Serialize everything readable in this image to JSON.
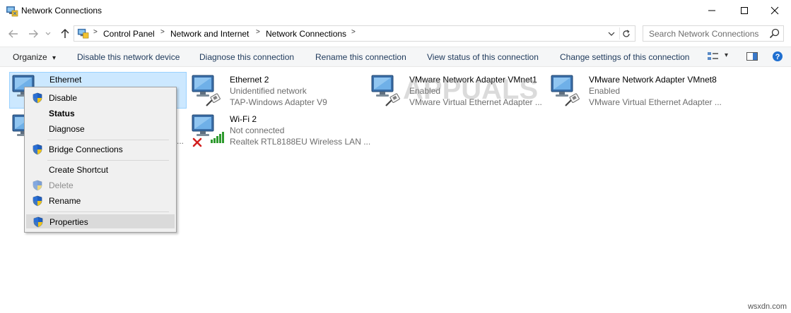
{
  "window": {
    "title": "Network Connections",
    "icon": "network-connections-icon",
    "controls": [
      "minimize-icon",
      "maximize-icon",
      "close-icon"
    ]
  },
  "address": {
    "crumbs": [
      "Control Panel",
      "Network and Internet",
      "Network Connections"
    ],
    "separator": ">",
    "search_placeholder": "Search Network Connections"
  },
  "toolbar": {
    "organize": "Organize",
    "organize_arrow": "▾",
    "commands": [
      "Disable this network device",
      "Diagnose this connection",
      "Rename this connection",
      "View status of this connection",
      "Change settings of this connection"
    ],
    "view_arrow": "▾"
  },
  "connections": [
    {
      "name": "Ethernet",
      "status": "",
      "adapter": "",
      "selected": true
    },
    {
      "name": "Ethernet 2",
      "status": "Unidentified network",
      "adapter": "TAP-Windows Adapter V9"
    },
    {
      "name": "VMware Network Adapter VMnet1",
      "status": "Enabled",
      "adapter": "VMware Virtual Ethernet Adapter ..."
    },
    {
      "name": "VMware Network Adapter VMnet8",
      "status": "Enabled",
      "adapter": "VMware Virtual Ethernet Adapter ..."
    },
    {
      "name": "Wi-Fi 2",
      "status": "Not connected",
      "adapter": "Realtek RTL8188EU Wireless LAN ..."
    },
    {
      "name": "",
      "status": "",
      "adapter": "..."
    }
  ],
  "context_menu": {
    "items": [
      {
        "label": "Disable",
        "shield": true
      },
      {
        "label": "Status",
        "bold": true
      },
      {
        "label": "Diagnose"
      },
      {
        "label": "Bridge Connections",
        "shield": true
      },
      {
        "label": "Create Shortcut"
      },
      {
        "label": "Delete",
        "shield": true,
        "disabled": true
      },
      {
        "label": "Rename",
        "shield": true
      },
      {
        "label": "Properties",
        "shield": true,
        "hover": true
      }
    ]
  },
  "watermark": "APPUALS",
  "footer": "wsxdn.com",
  "colors": {
    "selection_fill": "#cce8ff",
    "selection_border": "#99d1ff",
    "menu_bg": "#f0f0f0",
    "toolbar_bg": "#f5f6f7",
    "command_text": "#1e395b"
  }
}
